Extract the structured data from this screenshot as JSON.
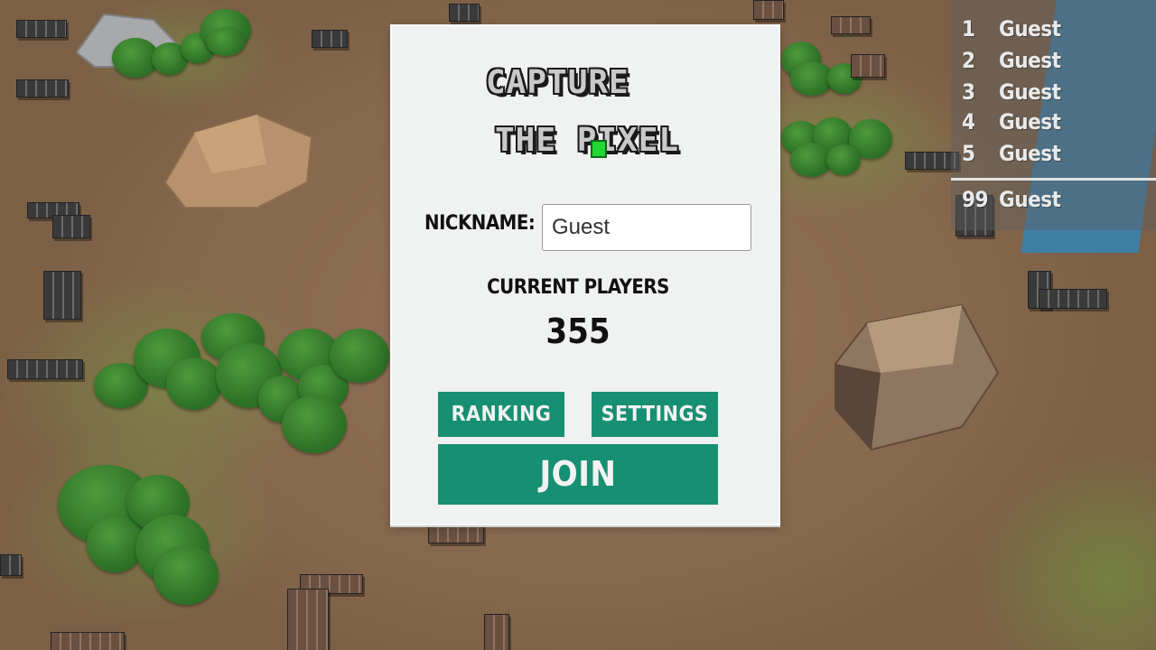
{
  "game": {
    "logo_line1": "CAPTURE",
    "logo_line2": "THE PIXEL"
  },
  "nickname": {
    "label": "NICKNAME:",
    "value": "Guest"
  },
  "players": {
    "label": "CURRENT PLAYERS",
    "count": "355"
  },
  "buttons": {
    "ranking": "RANKING",
    "settings": "SETTINGS",
    "join": "JOIN"
  },
  "leaderboard": {
    "top": [
      {
        "rank": "1",
        "name": "Guest"
      },
      {
        "rank": "2",
        "name": "Guest"
      },
      {
        "rank": "3",
        "name": "Guest"
      },
      {
        "rank": "4",
        "name": "Guest"
      },
      {
        "rank": "5",
        "name": "Guest"
      }
    ],
    "self": {
      "rank": "99",
      "name": "Guest"
    }
  },
  "colors": {
    "button": "#178f72",
    "panel": "#f0f1f1",
    "logo_pixel": "#22d633"
  }
}
